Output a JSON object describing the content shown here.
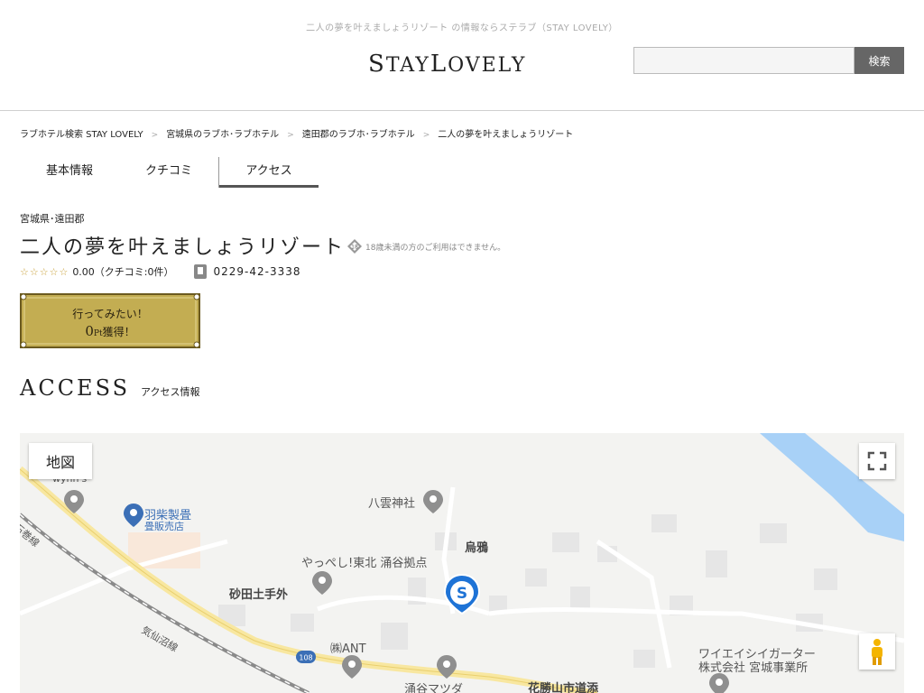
{
  "header": {
    "tagline": "二人の夢を叶えましょうリゾート の情報ならステラブ（STAY LOVELY）",
    "logo_s": "S",
    "logo_tay": "TAY",
    "logo_l": "L",
    "logo_ovely": "OVELY",
    "search_placeholder": "",
    "search_button": "検索"
  },
  "breadcrumb": [
    "ラブホテル検索 STAY LOVELY",
    "宮城県のラブホ･ラブホテル",
    "遠田郡のラブホ･ラブホテル",
    "二人の夢を叶えましょうリゾート"
  ],
  "breadcrumb_sep": ">",
  "tabs": [
    {
      "label": "基本情報"
    },
    {
      "label": "クチコミ"
    },
    {
      "label": "アクセス"
    }
  ],
  "hotel": {
    "region": "宮城県･遠田郡",
    "name": "二人の夢を叶えましょうリゾート",
    "age_notice": "18歳未満の方のご利用はできません。",
    "stars": "☆☆☆☆☆",
    "rating_text": "0.00（クチコミ:0件）",
    "rating_value": 0,
    "phone": "0229-42-3338"
  },
  "goto": {
    "line1": "行ってみたい！",
    "points": "0",
    "pt_unit": "Pt",
    "line2_suffix": "獲得！"
  },
  "access": {
    "title": "ACCESS",
    "subtitle": "アクセス情報"
  },
  "map": {
    "type_button": "地図",
    "labels": {
      "wynns": "wynn's",
      "hashiba": "羽柴製畳",
      "hashiba_sub": "畳販売店",
      "yakumo": "八雲神社",
      "karasu": "烏鴉",
      "yappeshi": "やっぺし!東北 涌谷拠点",
      "sunada": "砂田土手外",
      "ant": "㈱ANT",
      "route": "108",
      "mazda": "涌谷マツダ",
      "hanakatsu": "花勝山市道添",
      "waiei1": "ワイエイシイガーター",
      "waiei2": "株式会社 宮城事業所",
      "kesennuma": "気仙沼線",
      "ishinomaki": "石巻線"
    }
  },
  "colors": {
    "accent": "#555555",
    "gold": "#c9a13a",
    "map_bg": "#f3f3f1",
    "river": "#a8d1f7",
    "road": "#f8e7a0"
  }
}
